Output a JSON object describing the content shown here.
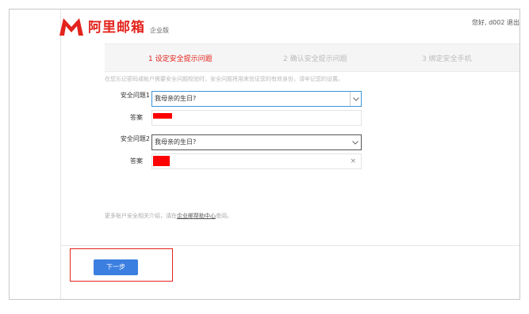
{
  "header": {
    "brand": "阿里邮箱",
    "edition": "企业版",
    "greeting": "您好, d002  退出"
  },
  "steps": [
    {
      "label": "1 设定安全提示问题",
      "active": true
    },
    {
      "label": "2 确认安全提示问题",
      "active": false
    },
    {
      "label": "3 绑定安全手机",
      "active": false
    }
  ],
  "notice": "在您忘记密码或帐户需要安全问题校验时，安全问题将用来验证您的有效身份，请牢记您的设置。",
  "form": {
    "question1_label": "安全问题1",
    "question1_value": "我母亲的生日?",
    "answer1_label": "答案",
    "question2_label": "安全问题2",
    "question2_value": "我母亲的生日?",
    "answer2_label": "答案",
    "clear_symbol": "×"
  },
  "help": {
    "prefix": "更多账户安全相关介绍，请在",
    "link": "企业邮帮助中心",
    "suffix": "查阅。"
  },
  "next_button": "下一步",
  "colors": {
    "brand": "#e3231c",
    "primary_button": "#3b7fe0",
    "active_border": "#3b94d9"
  }
}
